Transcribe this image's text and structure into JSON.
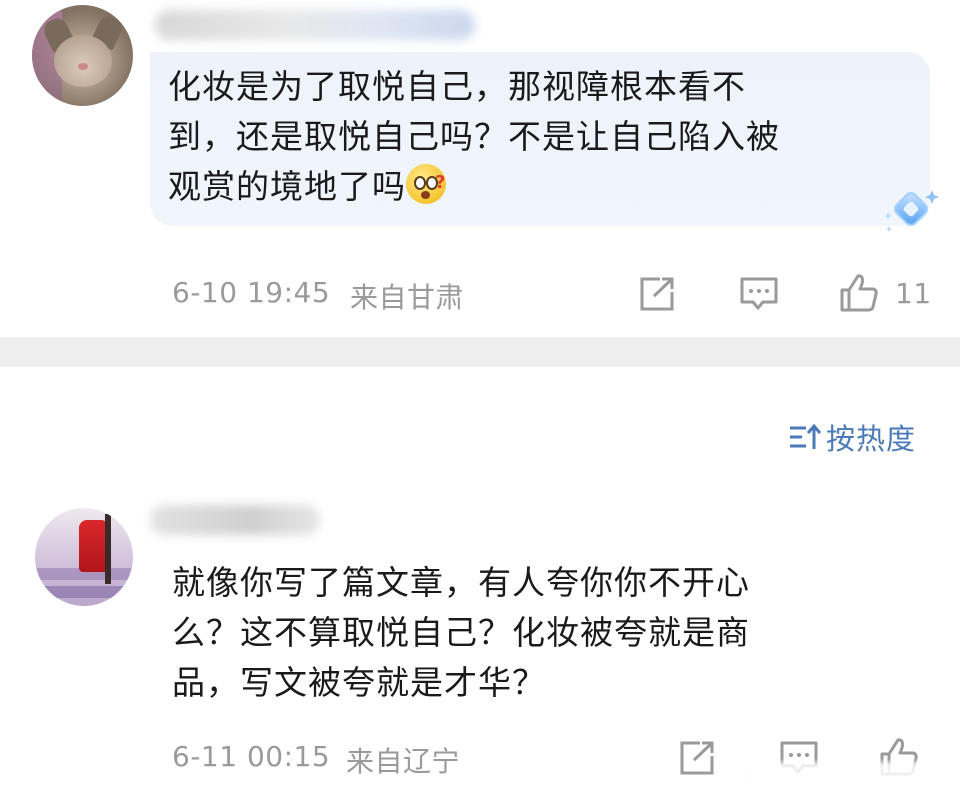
{
  "comments": [
    {
      "text_lines": [
        "化妆是为了取悦自己，那视障根本看不",
        "到，还是取悦自己吗？不是让自己陷入被",
        "观赏的境地了吗"
      ],
      "emoji": "thinking-face-emoji",
      "time": "6-10 19:45",
      "location": "来自甘肃",
      "like_count": "11"
    },
    {
      "text_lines": [
        "就像你写了篇文章，有人夸你你不开心",
        "么？这不算取悦自己？化妆被夸就是商",
        "品，写文被夸就是才华？"
      ],
      "time": "6-11 00:15",
      "location": "来自辽宁"
    }
  ],
  "sort": {
    "label": "按热度",
    "icon": "sort-icon"
  },
  "colors": {
    "accent": "#4a7ab8",
    "meta": "#9a9a9a",
    "bubble": "#eef3fb",
    "divider": "#efefef"
  }
}
